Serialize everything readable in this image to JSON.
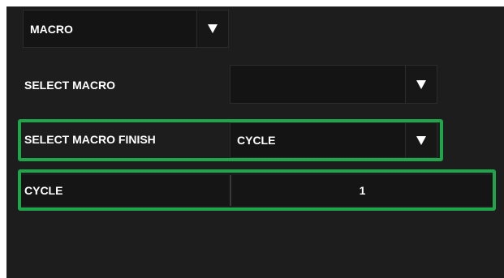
{
  "mode_select": {
    "value": "MACRO"
  },
  "select_macro": {
    "label": "SELECT MACRO",
    "value": ""
  },
  "select_macro_finish": {
    "label": "SELECT MACRO FINISH",
    "value": "CYCLE"
  },
  "cycle": {
    "label": "CYCLE",
    "value": "1"
  },
  "colors": {
    "highlight": "#1fa64a",
    "panel": "#1d1d1d"
  }
}
